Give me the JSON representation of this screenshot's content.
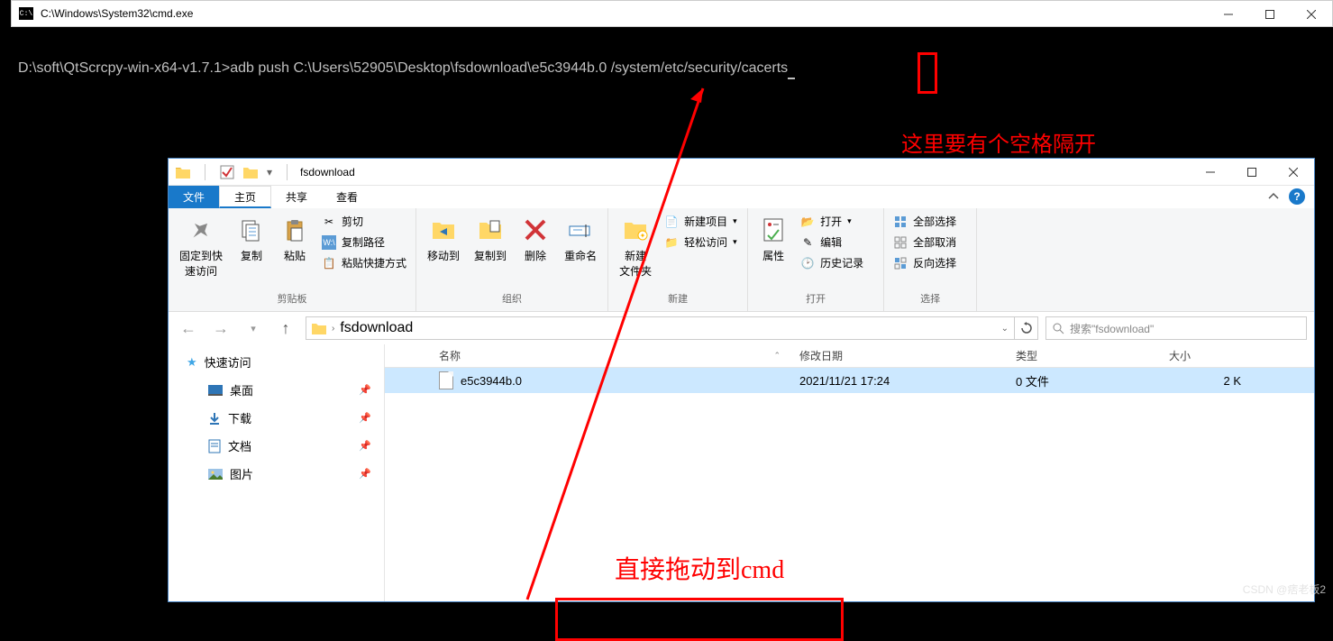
{
  "cmd": {
    "title": "C:\\Windows\\System32\\cmd.exe",
    "icon_label": "C:\\",
    "line_prompt": "D:\\soft\\QtScrcpy-win-x64-v1.7.1>",
    "line_command": "adb push C:\\Users\\52905\\Desktop\\fsdownload\\e5c3944b.0 /system/etc/security/cacerts"
  },
  "explorer": {
    "title": "fsdownload",
    "tabs": {
      "file": "文件",
      "home": "主页",
      "share": "共享",
      "view": "查看"
    },
    "ribbon": {
      "clipboard": {
        "pin": "固定到快\n速访问",
        "copy": "复制",
        "paste": "粘贴",
        "cut": "剪切",
        "copypath": "复制路径",
        "pasteshortcut": "粘贴快捷方式",
        "group": "剪贴板"
      },
      "organize": {
        "moveto": "移动到",
        "copyto": "复制到",
        "delete": "删除",
        "rename": "重命名",
        "group": "组织"
      },
      "new": {
        "newfolder": "新建\n文件夹",
        "newitem": "新建项目",
        "easyaccess": "轻松访问",
        "group": "新建"
      },
      "open": {
        "properties": "属性",
        "open": "打开",
        "edit": "编辑",
        "history": "历史记录",
        "group": "打开"
      },
      "select": {
        "selectall": "全部选择",
        "selectnone": "全部取消",
        "invert": "反向选择",
        "group": "选择"
      }
    },
    "breadcrumb": "fsdownload",
    "search_placeholder": "搜索\"fsdownload\"",
    "nav": {
      "quick": "快速访问",
      "desktop": "桌面",
      "downloads": "下载",
      "documents": "文档",
      "pictures": "图片"
    },
    "columns": {
      "name": "名称",
      "modified": "修改日期",
      "type": "类型",
      "size": "大小"
    },
    "file": {
      "name": "e5c3944b.0",
      "modified": "2021/11/21 17:24",
      "type": "0 文件",
      "size": "2 K"
    }
  },
  "annotations": {
    "space_note": "这里要有个空格隔开",
    "drag_note": "直接拖动到cmd"
  },
  "watermark": "CSDN @痞老板2"
}
